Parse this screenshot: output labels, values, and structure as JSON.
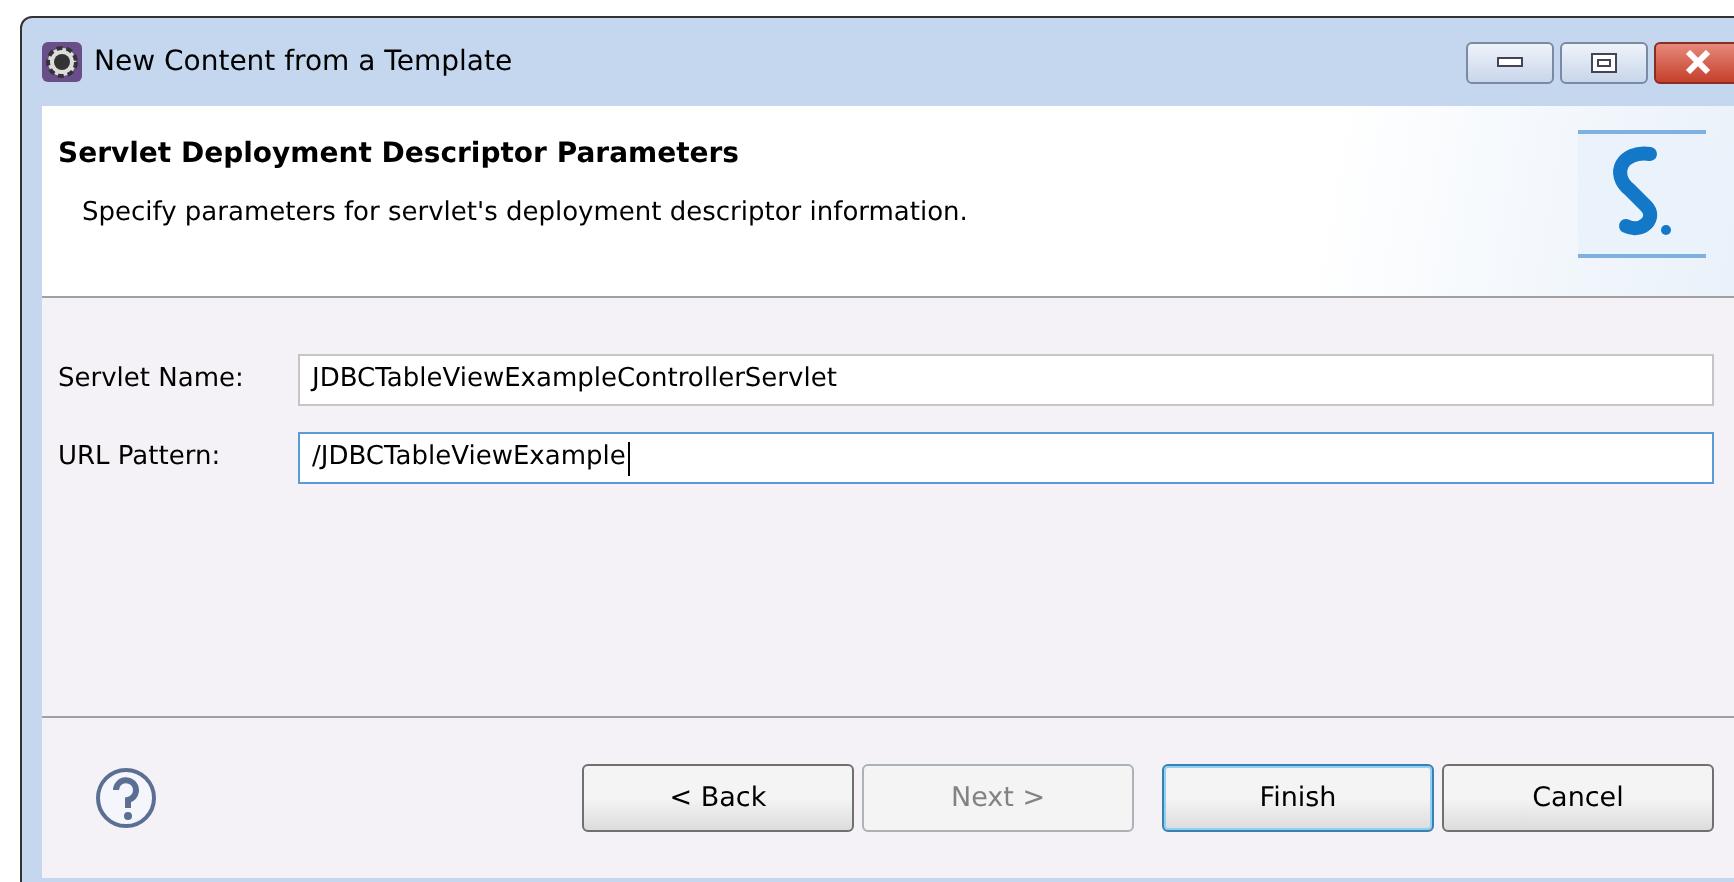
{
  "window": {
    "title": "New Content from a Template"
  },
  "header": {
    "title": "Servlet Deployment Descriptor Parameters",
    "description": "Specify parameters for servlet's deployment descriptor information."
  },
  "fields": [
    {
      "label": "Servlet Name:",
      "value": "JDBCTableViewExampleControllerServlet",
      "focused": false
    },
    {
      "label": "URL Pattern:",
      "value": "/JDBCTableViewExample",
      "focused": true
    }
  ],
  "buttons": [
    {
      "label": "< Back",
      "disabled": false,
      "default": false
    },
    {
      "label": "Next >",
      "disabled": true,
      "default": false
    },
    {
      "label": "Finish",
      "disabled": false,
      "default": true
    },
    {
      "label": "Cancel",
      "disabled": false,
      "default": false
    }
  ]
}
